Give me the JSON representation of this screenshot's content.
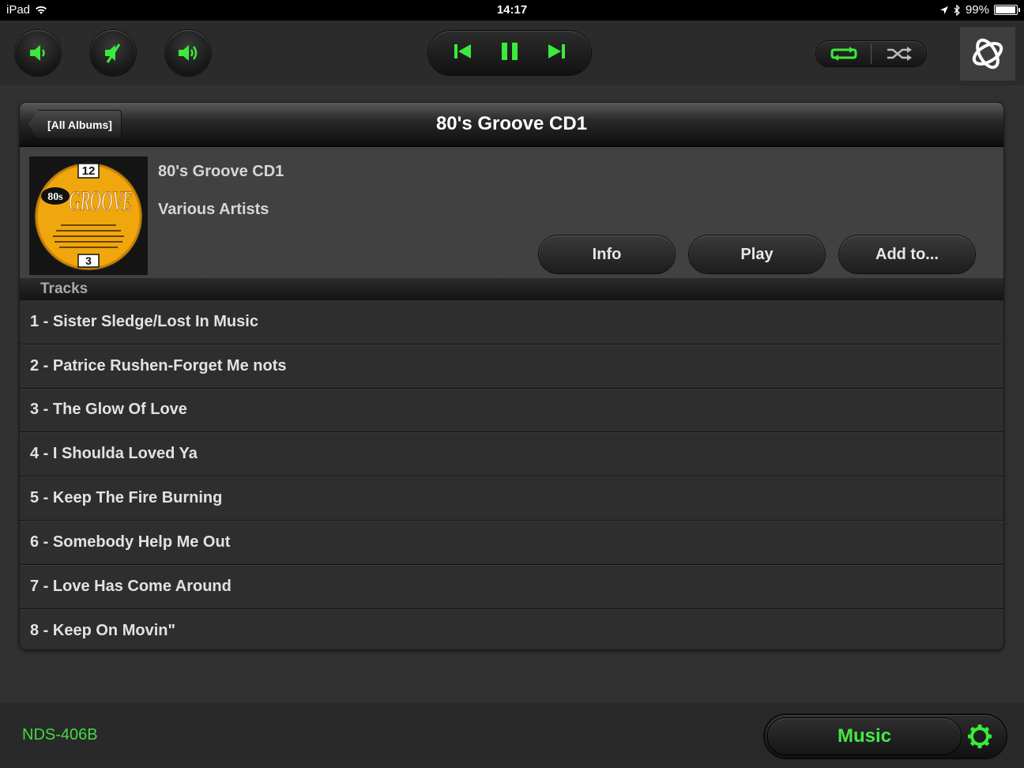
{
  "status": {
    "device": "iPad",
    "time": "14:17",
    "battery": "99%"
  },
  "toolbar": {
    "icons": [
      "volume-down-icon",
      "mute-icon",
      "volume-up-icon",
      "previous-icon",
      "pause-icon",
      "next-icon",
      "repeat-icon",
      "shuffle-icon",
      "logo-icon"
    ],
    "accent_color": "#3bea3b"
  },
  "panel": {
    "back_label": "[All Albums]",
    "title": "80's Groove CD1",
    "album": "80's Groove CD1",
    "artist": "Various Artists",
    "buttons": {
      "info": "Info",
      "play": "Play",
      "add": "Add to..."
    },
    "cover": {
      "top_badge": "12",
      "left_text": "80s",
      "main_text": "GROOVE",
      "bottom_badge": "3"
    },
    "tracks_header": "Tracks",
    "tracks": [
      "1 - Sister Sledge/Lost In Music",
      "2 - Patrice Rushen-Forget Me nots",
      "3 - The Glow Of Love",
      "4 - I Shoulda Loved Ya",
      "5 - Keep The Fire Burning",
      "6 - Somebody Help Me Out",
      "7 - Love Has Come Around",
      "8 - Keep On Movin\""
    ]
  },
  "bottom": {
    "device_name": "NDS-406B",
    "source_label": "Music"
  }
}
